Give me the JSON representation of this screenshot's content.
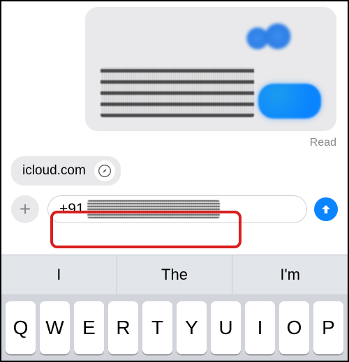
{
  "message": {
    "read_receipt": "Read"
  },
  "link_preview": {
    "domain": "icloud.com"
  },
  "compose": {
    "plus_glyph": "+",
    "input_prefix": "+91"
  },
  "keyboard": {
    "predictions": [
      "I",
      "The",
      "I'm"
    ],
    "row1": [
      "Q",
      "W",
      "E",
      "R",
      "T",
      "Y",
      "U",
      "I",
      "O",
      "P"
    ]
  },
  "colors": {
    "accent_blue": "#0a84ff",
    "bubble_gray": "#e9e9eb",
    "keyboard_bg": "#d1d4da",
    "highlight_red": "#d8201e"
  }
}
